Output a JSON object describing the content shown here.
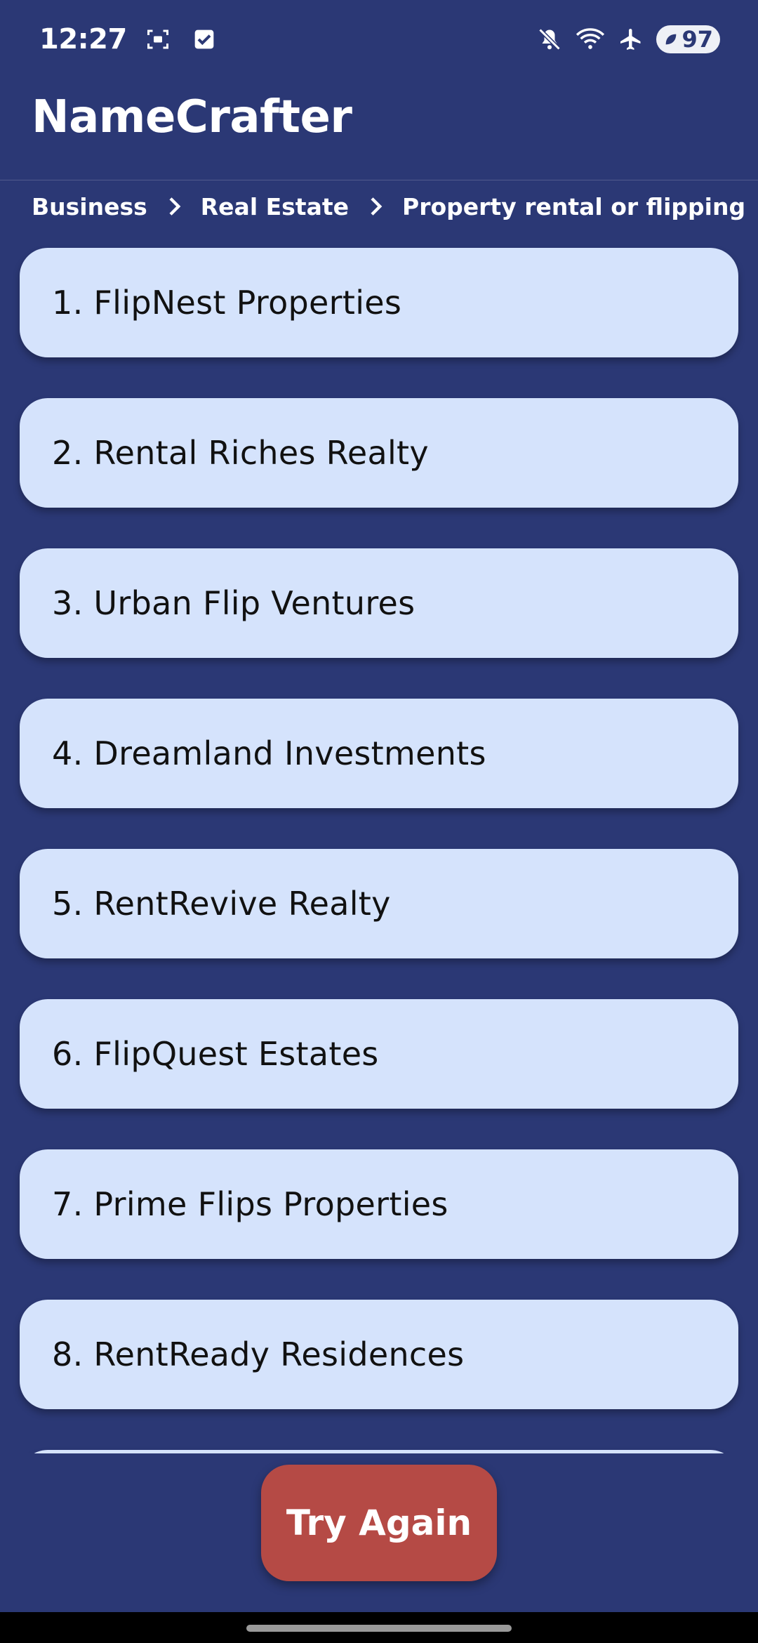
{
  "status_bar": {
    "time": "12:27",
    "icons": [
      "screenshot-icon",
      "checkbox-icon",
      "mute-icon",
      "wifi-icon",
      "airplane-icon"
    ],
    "battery": "97"
  },
  "app_bar": {
    "title": "NameCrafter"
  },
  "breadcrumb": {
    "items": [
      "Business",
      "Real Estate",
      "Property rental or flipping"
    ]
  },
  "names": [
    "1. FlipNest Properties",
    "2. Rental Riches Realty",
    "3. Urban Flip Ventures",
    "4. Dreamland Investments",
    "5. RentRevive Realty",
    "6. FlipQuest Estates",
    "7. Prime Flips Properties",
    "8. RentReady Residences"
  ],
  "actions": {
    "try_again": "Try Again"
  },
  "colors": {
    "background": "#2b3875",
    "card": "#d5e3fc",
    "button": "#b54a45"
  }
}
